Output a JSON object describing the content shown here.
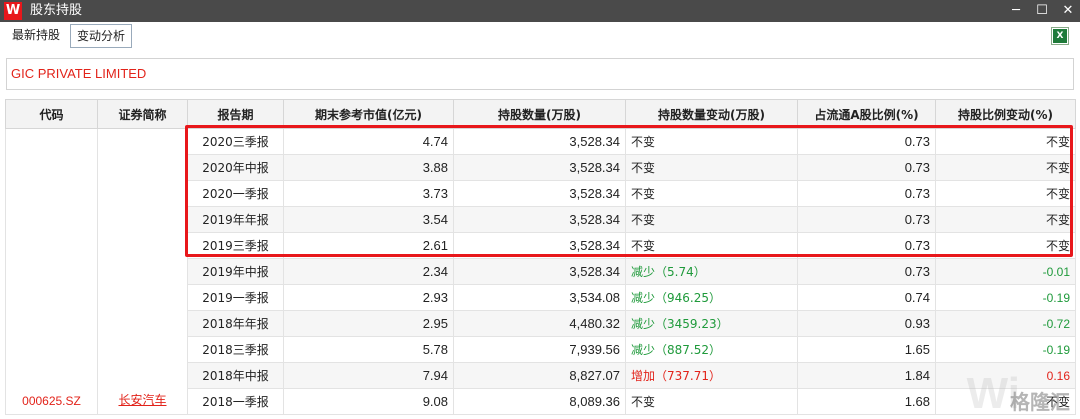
{
  "window": {
    "logo_letter": "W",
    "title": "股东持股",
    "controls": [
      "─",
      "☐",
      "✕"
    ]
  },
  "tabs": [
    {
      "label": "最新持股",
      "active": false
    },
    {
      "label": "变动分析",
      "active": true
    }
  ],
  "holder": {
    "name": "GIC PRIVATE LIMITED"
  },
  "table": {
    "columns": [
      "代码",
      "证券简称",
      "报告期",
      "期末参考市值(亿元)",
      "持股数量(万股)",
      "持股数量变动(万股)",
      "占流通A股比例(%)",
      "持股比例变动(%)"
    ],
    "security_code": "000625.SZ",
    "security_name": "长安汽车",
    "rows": [
      {
        "period": "2020三季报",
        "market_value": "4.74",
        "shares": "3,528.34",
        "change": "不变",
        "change_type": "neutral",
        "ratio": "0.73",
        "ratio_change": "不变"
      },
      {
        "period": "2020年中报",
        "market_value": "3.88",
        "shares": "3,528.34",
        "change": "不变",
        "change_type": "neutral",
        "ratio": "0.73",
        "ratio_change": "不变"
      },
      {
        "period": "2020一季报",
        "market_value": "3.73",
        "shares": "3,528.34",
        "change": "不变",
        "change_type": "neutral",
        "ratio": "0.73",
        "ratio_change": "不变"
      },
      {
        "period": "2019年年报",
        "market_value": "3.54",
        "shares": "3,528.34",
        "change": "不变",
        "change_type": "neutral",
        "ratio": "0.73",
        "ratio_change": "不变"
      },
      {
        "period": "2019三季报",
        "market_value": "2.61",
        "shares": "3,528.34",
        "change": "不变",
        "change_type": "neutral",
        "ratio": "0.73",
        "ratio_change": "不变"
      },
      {
        "period": "2019年中报",
        "market_value": "2.34",
        "shares": "3,528.34",
        "change": "减少（5.74）",
        "change_type": "green",
        "ratio": "0.73",
        "ratio_change": "-0.01"
      },
      {
        "period": "2019一季报",
        "market_value": "2.93",
        "shares": "3,534.08",
        "change": "减少（946.25）",
        "change_type": "green",
        "ratio": "0.74",
        "ratio_change": "-0.19"
      },
      {
        "period": "2018年年报",
        "market_value": "2.95",
        "shares": "4,480.32",
        "change": "减少（3459.23）",
        "change_type": "green",
        "ratio": "0.93",
        "ratio_change": "-0.72"
      },
      {
        "period": "2018三季报",
        "market_value": "5.78",
        "shares": "7,939.56",
        "change": "减少（887.52）",
        "change_type": "green",
        "ratio": "1.65",
        "ratio_change": "-0.19"
      },
      {
        "period": "2018年中报",
        "market_value": "7.94",
        "shares": "8,827.07",
        "change": "增加（737.71）",
        "change_type": "red",
        "ratio": "1.84",
        "ratio_change": "0.16"
      },
      {
        "period": "2018一季报",
        "market_value": "9.08",
        "shares": "8,089.36",
        "change": "不变",
        "change_type": "neutral",
        "ratio": "1.68",
        "ratio_change": "不变"
      }
    ]
  },
  "watermark": {
    "text": "格隆汇",
    "faint": "Wi"
  },
  "colors": {
    "accent_red": "#e2231a",
    "decrease_green": "#1f9a3b",
    "titlebar": "#4a4a4a"
  },
  "icons": {
    "export": "excel-export-icon"
  }
}
